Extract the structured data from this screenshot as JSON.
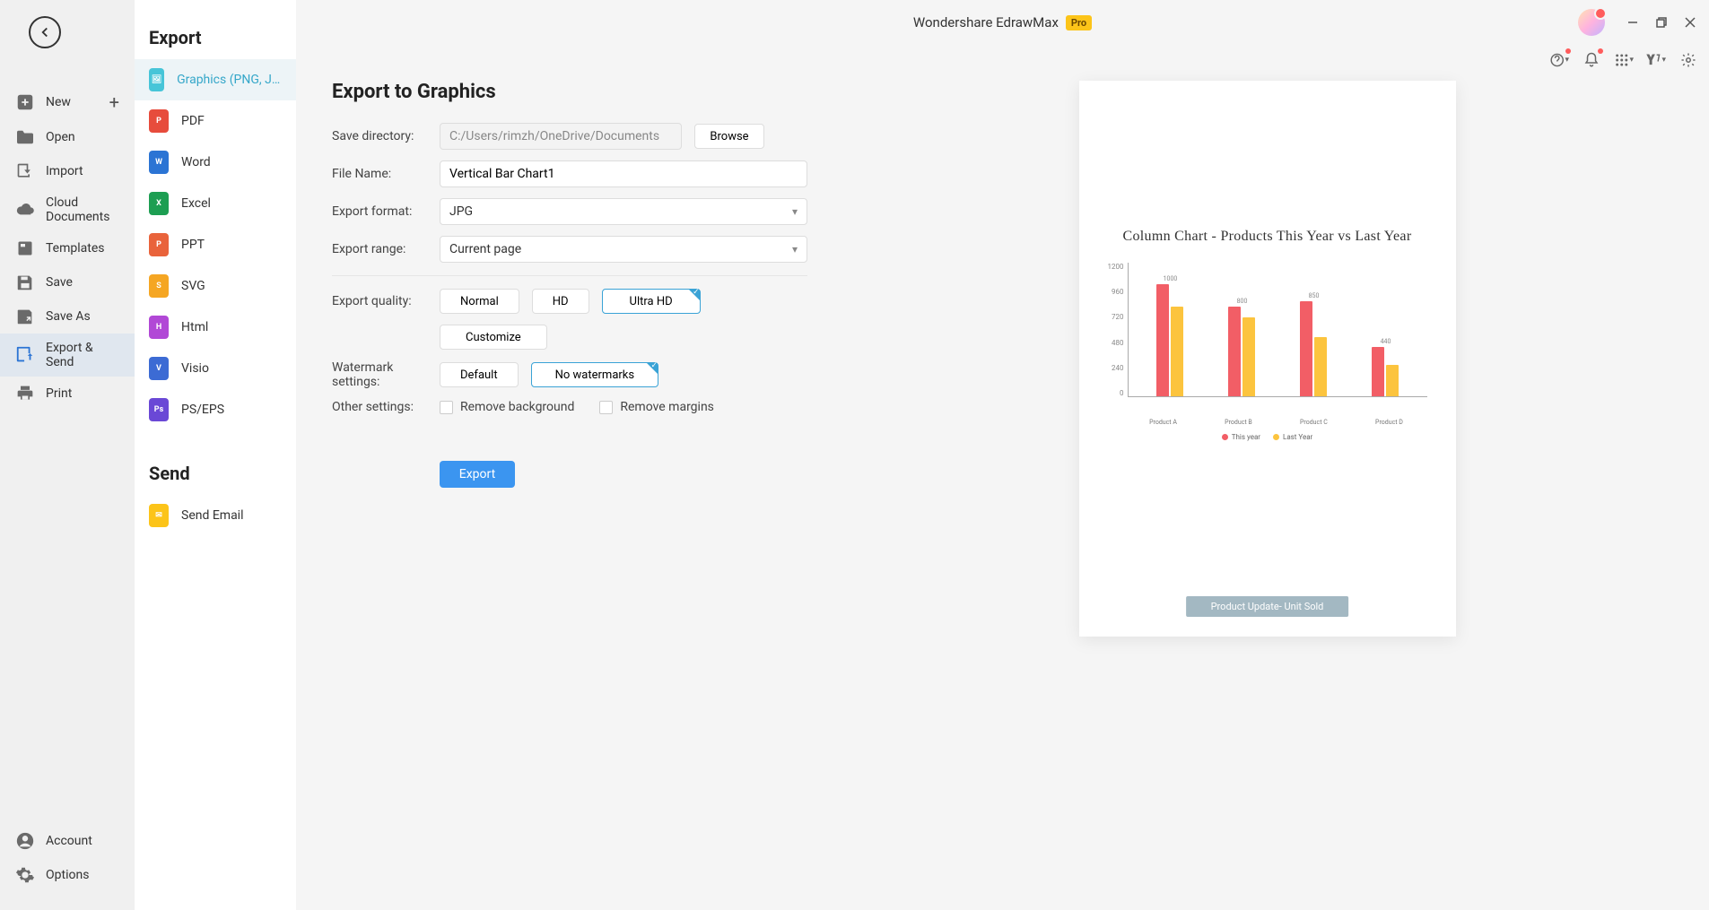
{
  "app": {
    "title": "Wondershare EdrawMax",
    "badge": "Pro"
  },
  "sidebar_left": {
    "items": [
      {
        "label": "New",
        "icon": "plus-square",
        "has_add": true
      },
      {
        "label": "Open",
        "icon": "folder"
      },
      {
        "label": "Import",
        "icon": "download"
      },
      {
        "label": "Cloud Documents",
        "icon": "cloud"
      },
      {
        "label": "Templates",
        "icon": "template"
      },
      {
        "label": "Save",
        "icon": "save"
      },
      {
        "label": "Save As",
        "icon": "save-as"
      },
      {
        "label": "Export & Send",
        "icon": "export",
        "active": true
      },
      {
        "label": "Print",
        "icon": "print"
      }
    ],
    "bottom": [
      {
        "label": "Account",
        "icon": "user"
      },
      {
        "label": "Options",
        "icon": "gear"
      }
    ]
  },
  "mid": {
    "export_heading": "Export",
    "send_heading": "Send",
    "export_types": [
      {
        "label": "Graphics (PNG, JPG et...",
        "color": "#47c5d8",
        "active": true
      },
      {
        "label": "PDF",
        "color": "#e74c3c"
      },
      {
        "label": "Word",
        "color": "#2b74d4"
      },
      {
        "label": "Excel",
        "color": "#1d9e52"
      },
      {
        "label": "PPT",
        "color": "#e9633b"
      },
      {
        "label": "SVG",
        "color": "#f5a623"
      },
      {
        "label": "Html",
        "color": "#b148d6"
      },
      {
        "label": "Visio",
        "color": "#3c6bd4"
      },
      {
        "label": "PS/EPS",
        "color": "#6a48d6"
      }
    ],
    "send_types": [
      {
        "label": "Send Email",
        "color": "#fcc419"
      }
    ]
  },
  "form": {
    "heading": "Export to Graphics",
    "labels": {
      "save_dir": "Save directory:",
      "file_name": "File Name:",
      "export_format": "Export format:",
      "export_range": "Export range:",
      "export_quality": "Export quality:",
      "watermark": "Watermark settings:",
      "other": "Other settings:"
    },
    "save_dir": "C:/Users/rimzh/OneDrive/Documents",
    "browse": "Browse",
    "file_name": "Vertical Bar Chart1",
    "export_format": "JPG",
    "export_range": "Current page",
    "quality": {
      "normal": "Normal",
      "hd": "HD",
      "ultra": "Ultra HD"
    },
    "customize": "Customize",
    "watermark": {
      "default": "Default",
      "none": "No watermarks"
    },
    "other": {
      "remove_bg": "Remove background",
      "remove_margin": "Remove margins"
    },
    "export_btn": "Export"
  },
  "chart_data": {
    "type": "bar",
    "title": "Column Chart - Products This Year vs Last Year",
    "categories": [
      "Product A",
      "Product B",
      "Product C",
      "Product D"
    ],
    "series": [
      {
        "name": "This year",
        "color": "#f25e66",
        "values": [
          1000,
          800,
          850,
          440
        ]
      },
      {
        "name": "Last Year",
        "color": "#fcc43e",
        "values": [
          800,
          700,
          530,
          280
        ]
      }
    ],
    "ylim": [
      0,
      1200
    ],
    "yticks": [
      0,
      240,
      480,
      720,
      960,
      1200
    ],
    "ylabel": "",
    "xlabel": "",
    "caption": "Product Update- Unit Sold"
  }
}
